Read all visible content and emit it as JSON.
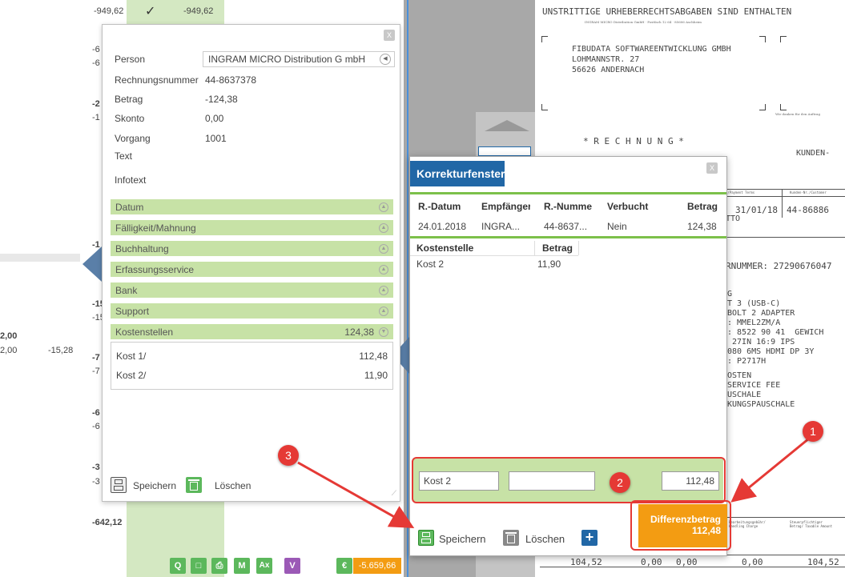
{
  "background": {
    "top_left_value": "-949,62",
    "top_green_value": "-949,62",
    "rows_mid": [
      "-6",
      "-6",
      "-2",
      "-1",
      "-1",
      "-1"
    ],
    "left_values": [
      "2,00",
      "2,00"
    ],
    "left_neg": "-15,28",
    "rows_lower": [
      "-15",
      "-15",
      "-7",
      "-7",
      "-6",
      "-6",
      "-3",
      "-3"
    ],
    "total": "-642,12",
    "total_bold_left": "-1"
  },
  "panel1": {
    "close": "X",
    "person_label": "Person",
    "person_value": "INGRAM MICRO Distribution G mbH",
    "rechnungsnummer_label": "Rechnungsnummer",
    "rechnungsnummer_value": "44-8637378",
    "betrag_label": "Betrag",
    "betrag_value": "-124,38",
    "skonto_label": "Skonto",
    "skonto_value": "0,00",
    "vorgang_label": "Vorgang",
    "vorgang_value": "1001",
    "text_label": "Text",
    "infotext_label": "Infotext",
    "sections": [
      "Datum",
      "Fälligkeit/Mahnung",
      "Buchhaltung",
      "Erfassungsservice",
      "Bank",
      "Support"
    ],
    "kostenstellen_label": "Kostenstellen",
    "kostenstellen_value": "124,38",
    "kosten": [
      {
        "name": "Kost 1/",
        "value": "112,48"
      },
      {
        "name": "Kost 2/",
        "value": "11,90"
      }
    ],
    "save_label": "Speichern",
    "delete_label": "Löschen"
  },
  "panel2": {
    "title": "Korrekturfenster",
    "close": "X",
    "headers": [
      "R.-Datum",
      "Empfänger",
      "R.-Numme",
      "Verbucht",
      "Betrag"
    ],
    "row": [
      "24.01.2018",
      "INGRA...",
      "44-8637...",
      "Nein",
      "124,38"
    ],
    "ks_headers": [
      "Kostenstelle",
      "Betrag"
    ],
    "ks_rows": [
      {
        "name": "Kost 2",
        "value": "11,90"
      }
    ],
    "input_name": "Kost 2",
    "input_mid": "",
    "input_amount": "112,48",
    "save_label": "Speichern",
    "delete_label": "Löschen",
    "add_label": "+",
    "diff_label": "Differenzbetrag",
    "diff_value": "112,48"
  },
  "badges": [
    "1",
    "2",
    "3"
  ],
  "document": {
    "line1": "UNSTRITTIGE URHEBERRECHTSABGABEN SIND ENTHALTEN",
    "small_addr": "INGRAM MICRO Distribution GmbH · Postfach 12 64 · 85606 Aschheim",
    "addr1": "FIBUDATA SOFTWAREENTWICKLUNG GMBH",
    "addr2": "LOHMANNSTR. 27",
    "addr3": "56626 ANDERNACH",
    "rechnung": "* R E C H N U N G *",
    "kunden": "KUNDEN-",
    "date": "31/01/18",
    "kundennr": "44-86886",
    "netto": "TTO",
    "auftrag": "RNUMMER: 27290676047",
    "items": [
      "G",
      "T 3 (USB-C)",
      "BOLT 2 ADAPTER",
      ": MMEL2ZM/A",
      ": 8522 90 41  GEWICH",
      " 27IN 16:9 IPS",
      "080 6MS HDMI DP 3Y",
      ": P2717H",
      "OSTEN",
      "SERVICE FEE",
      "USCHALE",
      "KUNGSPAUSCHALE"
    ],
    "totals": [
      "104,52",
      "0,00",
      "0,00",
      "0,00",
      "104,52"
    ],
    "col_head_1": "Bearbeitungsgebühr/ Handling Charge",
    "col_head_2": "Steuerpflichtiger Betrag/ Taxable Amount",
    "side_text": "Wir danken für den Auftrag",
    "terms_head": "n/Payment Terms",
    "kunden_head": "Kunden-Nr./Customer"
  },
  "toolbar": {
    "total": "-5.659,66",
    "buttons": [
      "Q",
      "□",
      "⎙",
      "M",
      "Ax",
      "V",
      "€"
    ]
  },
  "colors": {
    "accent_blue": "#2167a6",
    "green_light": "#c7e2a6",
    "green_line": "#7cc04a",
    "orange": "#f39c12",
    "red": "#e53935"
  }
}
